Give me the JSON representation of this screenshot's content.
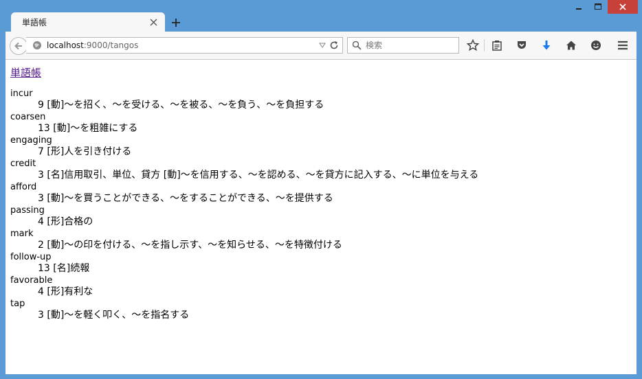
{
  "browser": {
    "tab_title": "単語帳",
    "url_host": "localhost",
    "url_rest": ":9000/tangos",
    "search_placeholder": "検索",
    "accent": "#5b9bd5",
    "close_color": "#c7413a",
    "download_color": "#1a7ae8"
  },
  "page": {
    "title_link": "単語帳",
    "entries": [
      {
        "word": "incur",
        "count": "9",
        "meaning": "[動]～を招く、～を受ける、～を被る、～を負う、～を負担する"
      },
      {
        "word": "coarsen",
        "count": "13",
        "meaning": "[動]～を粗雑にする"
      },
      {
        "word": "engaging",
        "count": "7",
        "meaning": "[形]人を引き付ける"
      },
      {
        "word": "credit",
        "count": "3",
        "meaning": "[名]信用取引、単位、貸方 [動]～を信用する、～を認める、～を貸方に記入する、～に単位を与える"
      },
      {
        "word": "afford",
        "count": "3",
        "meaning": "[動]～を買うことができる、～をすることができる、～を提供する"
      },
      {
        "word": "passing",
        "count": "4",
        "meaning": "[形]合格の"
      },
      {
        "word": "mark",
        "count": "2",
        "meaning": "[動]～の印を付ける、～を指し示す、～を知らせる、～を特徴付ける"
      },
      {
        "word": "follow-up",
        "count": "13",
        "meaning": "[名]続報"
      },
      {
        "word": "favorable",
        "count": "4",
        "meaning": "[形]有利な"
      },
      {
        "word": "tap",
        "count": "3",
        "meaning": "[動]～を軽く叩く、～を指名する"
      }
    ]
  }
}
